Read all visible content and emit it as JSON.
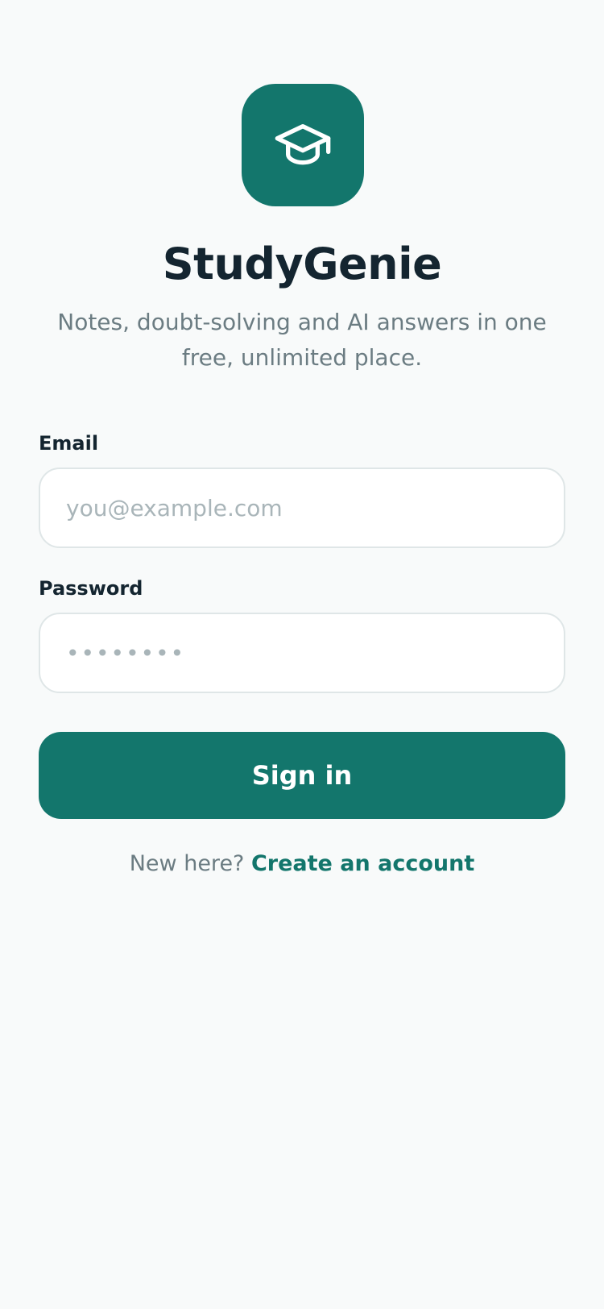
{
  "app": {
    "name": "StudyGenie",
    "tagline": "Notes, doubt-solving and AI answers in one free, unlimited place.",
    "logo_icon": "graduation-cap-icon",
    "brand_color": "#13766c",
    "background_color": "#f8fafa"
  },
  "form": {
    "email": {
      "label": "Email",
      "placeholder": "you@example.com",
      "value": ""
    },
    "password": {
      "label": "Password",
      "placeholder": "••••••••",
      "value": ""
    },
    "submit_label": "Sign in"
  },
  "footer": {
    "prompt": "New here?",
    "link_label": "Create an account"
  }
}
